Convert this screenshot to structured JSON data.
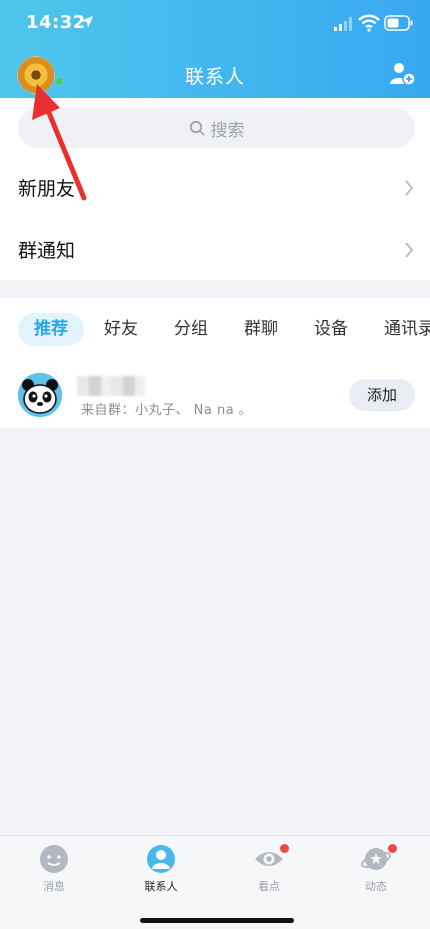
{
  "status_bar": {
    "time": "14:32"
  },
  "header": {
    "title": "联系人"
  },
  "search": {
    "placeholder": "搜索"
  },
  "menu": [
    {
      "label": "新朋友"
    },
    {
      "label": "群通知"
    }
  ],
  "tabs": [
    {
      "label": "推荐",
      "active": true
    },
    {
      "label": "好友"
    },
    {
      "label": "分组"
    },
    {
      "label": "群聊"
    },
    {
      "label": "设备"
    },
    {
      "label": "通讯录"
    }
  ],
  "recommendation": {
    "source": "来自群：小丸子、 Na na 。",
    "add_label": "添加"
  },
  "tabbar": [
    {
      "label": "消息",
      "icon": "message-icon"
    },
    {
      "label": "联系人",
      "icon": "contacts-icon",
      "active": true
    },
    {
      "label": "看点",
      "icon": "eye-icon",
      "badge": true
    },
    {
      "label": "动态",
      "icon": "planet-icon",
      "badge": true
    }
  ],
  "colors": {
    "accent": "#29a8e6",
    "header_start": "#4fc6ec",
    "header_end": "#38a8f0",
    "badge": "#ef4b3c",
    "annotation_arrow": "#e8312f"
  }
}
